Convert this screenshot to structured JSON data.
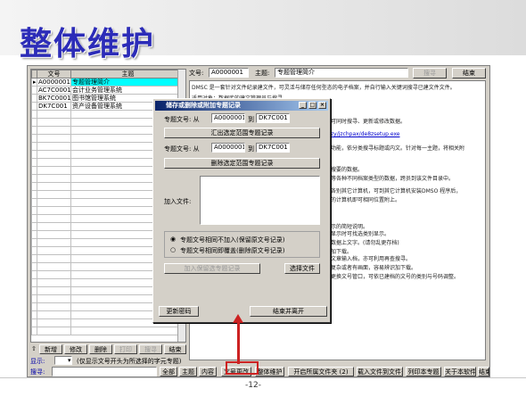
{
  "slide": {
    "title": "整体维护",
    "page": "-12-"
  },
  "grid": {
    "headers": [
      "文号",
      "主题"
    ],
    "rows": [
      {
        "no": "A0000001",
        "title": "专题管理简介",
        "selected": true
      },
      {
        "no": "AC7C0001",
        "title": "会计业务管理系统",
        "selected": false
      },
      {
        "no": "BK7C0001",
        "title": "图书馆管理系统",
        "selected": false
      },
      {
        "no": "DK7C001",
        "title": "资产设备管理系统",
        "selected": false
      }
    ]
  },
  "topbar": {
    "doc_label": "文号:",
    "doc_value": "A0000001",
    "subject_label": "主题:",
    "subject_value": "专题管理简介",
    "search_label": "搜寻",
    "close_label": "结束"
  },
  "content_lines": [
    "DMSC 是一套针对文件纪录建文件，可灵活与储存任何型态的电子档案，并自行输入关键词搜寻已建文件文件。",
    "适用对象：数据库的建文管理员与搜寻。",
    "可同时搜寻、更新或修改数据。",
    "zy/jzchpax/de8zsetup.exe",
    "功能，依分类搜寻标题或内文。针对每一主题，将相关附",
    "搜要的数据。",
    "等各种不同档案类型的数据，跨员到该文件目录中。",
    "各别其它计算机，可到其它计算机安装DMSO 程序后，",
    "的计算机即可相同位置附上。",
    "示的简短说明。",
    "显示时可找选类别显示。",
    "数据上文字。(请勿乱更存档)",
    "加下载。",
    "文章输入档，亦可利用再查搜寻。",
    "复杂或者有画面，容易辨识加下载。",
    "更换文号管口，可依已建档的文号的类别与号码调整。"
  ],
  "dialog": {
    "title": "储存或删除或附加专题记录",
    "range_label": "专题文号: 从",
    "from1": "A0000001",
    "to_label": "到",
    "to1": "DK7C001",
    "export_btn": "汇出选定范围专题记录",
    "from2": "A0000001",
    "to2": "DK7C001",
    "delete_btn": "删除选定范围专题记录",
    "join_label": "加入文件:",
    "radio1": "专题文号相同不加入(保留原文号记录)",
    "radio2": "专题文号相同即覆盖(删除原文号记录)",
    "join_btn": "加入保留选专题记录",
    "choose_btn": "选择文件",
    "pwd_btn": "更新密码",
    "exit_btn": "结束并离开"
  },
  "left_buttons": [
    "新增",
    "修改",
    "删除",
    "打印",
    "搜寻",
    "结束"
  ],
  "display": {
    "label": "显示:",
    "value": "",
    "hint": "(仅显示文号开头为所选择的字元专题)"
  },
  "search": {
    "label": "搜寻:",
    "value": "",
    "all": "全部",
    "subject": "主题",
    "content": "内容"
  },
  "bottom_buttons": [
    "文号更改",
    "整体维护",
    "开启所属文件夹 (2)",
    "载入文件到文件夹",
    "列印本专题",
    "关于本软件",
    "结束"
  ]
}
